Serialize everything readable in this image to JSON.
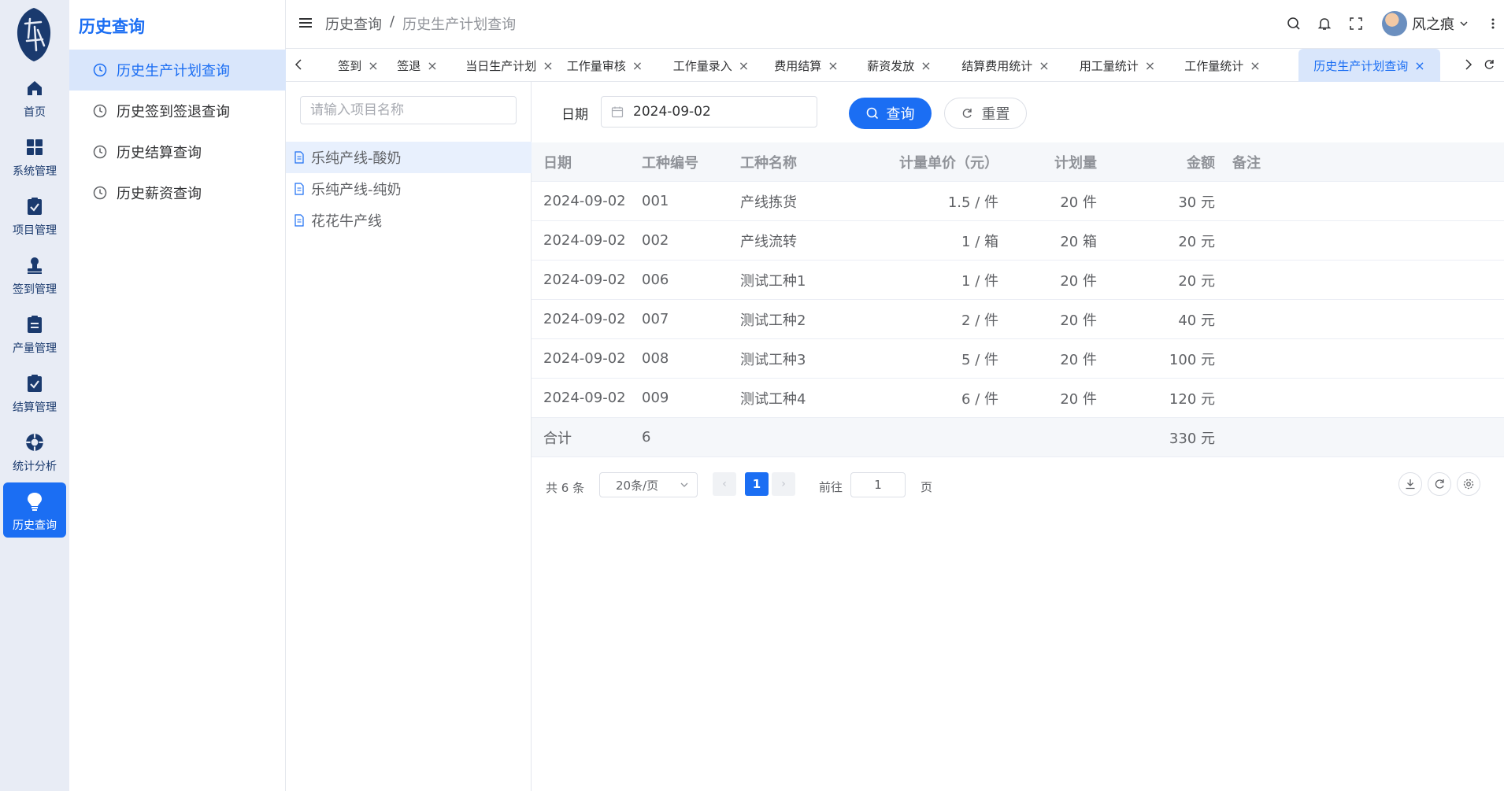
{
  "rail": {
    "logo_text": "有鹿",
    "items": [
      {
        "label": "首页",
        "icon": "home-icon"
      },
      {
        "label": "系统管理",
        "icon": "grid-icon"
      },
      {
        "label": "项目管理",
        "icon": "clipboard-check-icon"
      },
      {
        "label": "签到管理",
        "icon": "user-stamp-icon"
      },
      {
        "label": "产量管理",
        "icon": "clipboard-list-icon"
      },
      {
        "label": "结算管理",
        "icon": "clipboard-check-icon"
      },
      {
        "label": "统计分析",
        "icon": "compass-icon"
      },
      {
        "label": "历史查询",
        "icon": "lightbulb-icon",
        "active": true
      }
    ]
  },
  "submenu": {
    "title": "历史查询",
    "items": [
      {
        "label": "历史生产计划查询",
        "active": true
      },
      {
        "label": "历史签到签退查询"
      },
      {
        "label": "历史结算查询"
      },
      {
        "label": "历史薪资查询"
      }
    ]
  },
  "header": {
    "breadcrumb": [
      "历史查询",
      "历史生产计划查询"
    ],
    "breadcrumb_sep": "/",
    "username": "风之痕"
  },
  "tabs": [
    {
      "label": "签到"
    },
    {
      "label": "签退"
    },
    {
      "label": "当日生产计划"
    },
    {
      "label": "工作量审核"
    },
    {
      "label": "工作量录入"
    },
    {
      "label": "费用结算"
    },
    {
      "label": "薪资发放"
    },
    {
      "label": "结算费用统计"
    },
    {
      "label": "用工量统计"
    },
    {
      "label": "工作量统计"
    },
    {
      "label": "历史生产计划查询",
      "active": true
    }
  ],
  "tree": {
    "search_placeholder": "请输入项目名称",
    "nodes": [
      {
        "label": "乐纯产线-酸奶",
        "active": true
      },
      {
        "label": "乐纯产线-纯奶"
      },
      {
        "label": "花花牛产线"
      }
    ]
  },
  "filter": {
    "date_label": "日期",
    "date_value": "2024-09-02",
    "query_label": "查询",
    "reset_label": "重置"
  },
  "table": {
    "columns": [
      "日期",
      "工种编号",
      "工种名称",
      "计量单价（元）",
      "计划量",
      "金额",
      "备注"
    ],
    "rows": [
      {
        "date": "2024-09-02",
        "code": "001",
        "name": "产线拣货",
        "price": "1.5 / 件",
        "qty": "20 件",
        "amount": "30 元",
        "note": ""
      },
      {
        "date": "2024-09-02",
        "code": "002",
        "name": "产线流转",
        "price": "1 / 箱",
        "qty": "20 箱",
        "amount": "20 元",
        "note": ""
      },
      {
        "date": "2024-09-02",
        "code": "006",
        "name": "测试工种1",
        "price": "1 / 件",
        "qty": "20 件",
        "amount": "20 元",
        "note": ""
      },
      {
        "date": "2024-09-02",
        "code": "007",
        "name": "测试工种2",
        "price": "2 / 件",
        "qty": "20 件",
        "amount": "40 元",
        "note": ""
      },
      {
        "date": "2024-09-02",
        "code": "008",
        "name": "测试工种3",
        "price": "5 / 件",
        "qty": "20 件",
        "amount": "100 元",
        "note": ""
      },
      {
        "date": "2024-09-02",
        "code": "009",
        "name": "测试工种4",
        "price": "6 / 件",
        "qty": "20 件",
        "amount": "120 元",
        "note": ""
      }
    ],
    "footer": {
      "label": "合计",
      "count": "6",
      "amount": "330 元"
    }
  },
  "pagination": {
    "total": "共 6 条",
    "page_size": "20条/页",
    "current": "1",
    "goto_label": "前往",
    "goto_value": "1",
    "page_unit": "页"
  },
  "colors": {
    "accent": "#1b6ef3",
    "rail_bg": "#e8ecf5",
    "active_bg": "#d9e6fb"
  }
}
